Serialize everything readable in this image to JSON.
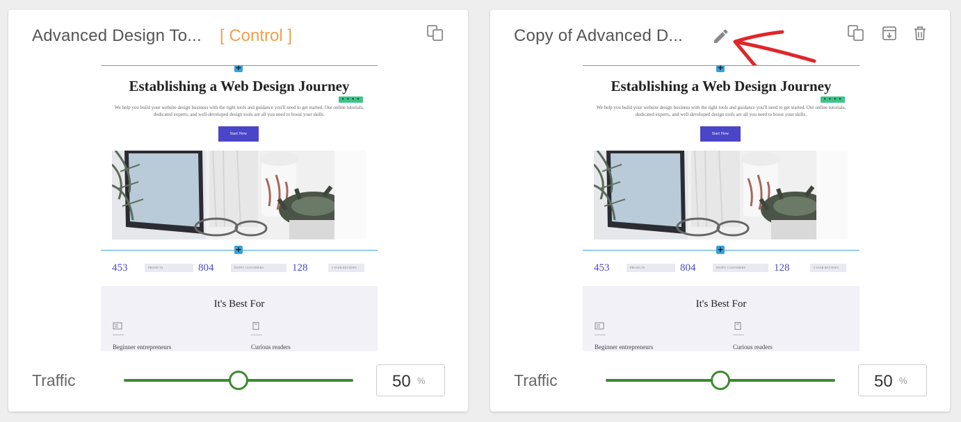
{
  "cards": [
    {
      "title": "Advanced Design To...",
      "badge": "[ Control ]",
      "actions": [
        "duplicate-icon"
      ],
      "traffic": {
        "label": "Traffic",
        "value": "50",
        "unit": "%",
        "fraction": 0.5
      }
    },
    {
      "title": "Copy of Advanced D...",
      "actions": [
        "edit-pencil-icon",
        "duplicate-icon",
        "archive-icon",
        "trash-icon"
      ],
      "traffic": {
        "label": "Traffic",
        "value": "50",
        "unit": "%",
        "fraction": 0.5
      }
    }
  ],
  "preview": {
    "heading": "Establishing a Web Design Journey",
    "subtext": "We help you build your website design business with the right tools and guidance you'll need to get started. Our online tutorials, dedicated experts, and well-developed design tools are all you need to boost your skills.",
    "button": "Start Now",
    "plus": "+",
    "stats": [
      {
        "number": "453",
        "label": "PROJECTS"
      },
      {
        "number": "804",
        "label": "HAPPY CUSTOMERS"
      },
      {
        "number": "128",
        "label": "5 STAR REVIEWS"
      }
    ],
    "best_for_title": "It's Best For",
    "best_for_items": [
      "Beginner entrepreneurs",
      "Curious readers"
    ]
  },
  "colors": {
    "slider": "#3c8a2e",
    "control_badge": "#f0a04b",
    "accent_button": "#4b45c8",
    "annotation_arrow": "#e0262a"
  }
}
